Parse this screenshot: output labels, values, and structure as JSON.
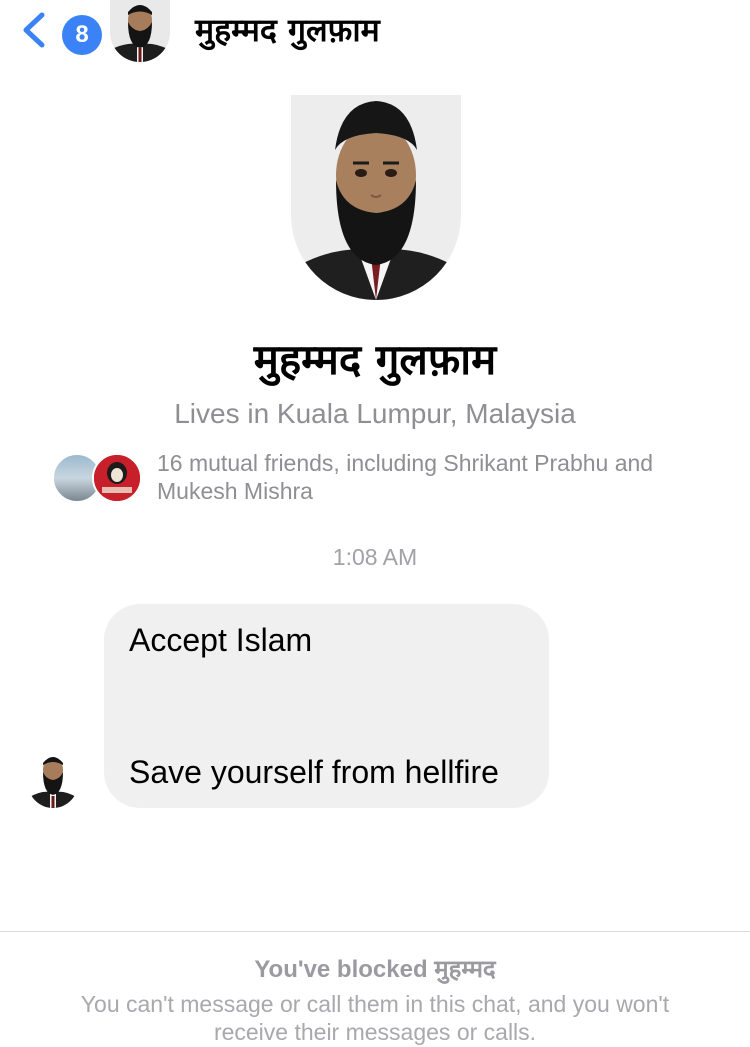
{
  "header": {
    "unread_count": "8",
    "contact_name": "मुहम्मद गुलफ़ाम"
  },
  "profile": {
    "name": "मुहम्मद गुलफ़ाम",
    "location": "Lives in Kuala Lumpur, Malaysia",
    "mutual_friends": "16 mutual friends, including Shrikant Prabhu and Mukesh Mishra"
  },
  "conversation": {
    "timestamp": "1:08 AM",
    "messages": [
      {
        "line1": "Accept Islam",
        "line2": "Save yourself from hellfire"
      }
    ]
  },
  "blocked_notice": {
    "title_prefix": "You've blocked",
    "title_name": "मुहम्मद",
    "description": "You can't message or call them in this chat, and you won't receive their messages or calls."
  },
  "colors": {
    "accent": "#3b82f6",
    "secondary_text": "#8e8e93",
    "bubble": "#f0f0f0"
  },
  "icons": {
    "back": "chevron-left-icon"
  }
}
